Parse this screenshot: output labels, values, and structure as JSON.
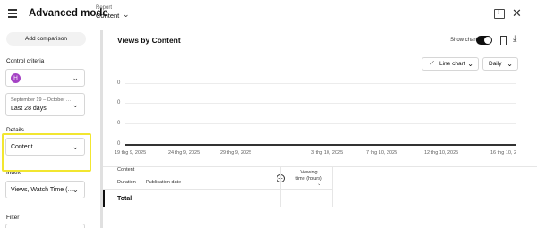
{
  "header": {
    "title": "Advanced mode",
    "report_label": "Report",
    "report_value": "Content"
  },
  "sidebar": {
    "add_comparison_label": "Add comparison",
    "control_criteria": {
      "label": "Control criteria",
      "avatar_initial": "H"
    },
    "date_range": {
      "range_text": "September 19 – October …",
      "value": "Last 28 days"
    },
    "details": {
      "label": "Details",
      "value": "Content"
    },
    "index": {
      "label": "Index",
      "value": "Views, Watch Time (…"
    },
    "filter": {
      "label": "Filter"
    }
  },
  "chart": {
    "title": "Views by Content",
    "show_chart_label": "Show chart",
    "show_chart_on": true,
    "chart_type_label": "Line chart",
    "granularity_label": "Daily"
  },
  "chart_data": {
    "type": "line",
    "y_tick_labels": [
      "0",
      "0",
      "0",
      "0"
    ],
    "x_tick_labels": [
      "19 thg 9, 2025",
      "24 thg 9, 2025",
      "29 thg 9, 2025",
      "3 thg 10, 2025",
      "7 thg 10, 2025",
      "12 thg 10, 2025",
      "16 thg 10, 2"
    ],
    "series": []
  },
  "table": {
    "content_header": "Content",
    "duration_header": "Duration",
    "publication_date_header": "Publication date",
    "metric_header": "Viewing time (hours)",
    "total_label": "Total",
    "total_value": "—"
  },
  "colors": {
    "avatar": "#a442c4",
    "highlight": "#f2e630",
    "toggle_on": "#0f0f0f"
  }
}
